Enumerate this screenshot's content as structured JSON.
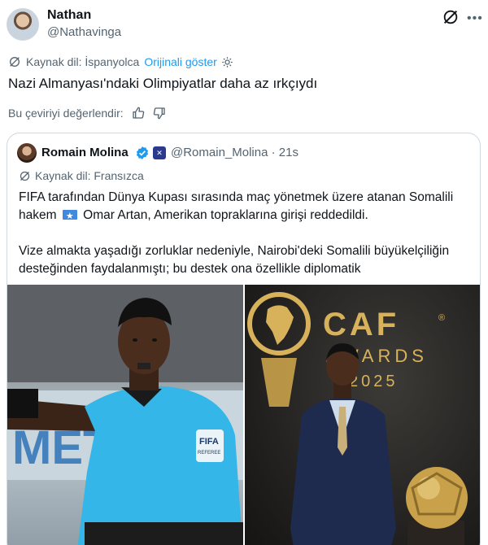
{
  "tweet": {
    "author_name": "Nathan",
    "author_handle": "@Nathavinga",
    "source_label": "Kaynak dil: İspanyolca",
    "show_original": "Orijinali göster",
    "text": "Nazi Almanyası'ndaki Olimpiyatlar daha az ırkçıydı",
    "rate_prompt": "Bu çeviriyi değerlendir:"
  },
  "quote": {
    "author_name": "Romain Molina",
    "handle_time": "@Romain_Molina · 21s",
    "source_label": "Kaynak dil: Fransızca",
    "line1": "FIFA tarafından Dünya Kupası sırasında maç yönetmek üzere atanan Somalili",
    "line2_pre": "hakem",
    "line2_post": "Omar Artan, Amerikan topraklarına girişi reddedildi.",
    "line3": "Vize almakta yaşadığı zorluklar nedeniyle, Nairobi'deki Somalili büyükelçiliğin",
    "line4": "desteğinden faydalanmıştı; bu destek ona özellikle diplomatik"
  },
  "images": {
    "left_sign": "METRO",
    "left_badge": "FIFA",
    "left_badge_sub": "REFEREE",
    "right_logo": "CAF",
    "right_reg": "®",
    "right_awards": "AWARDS",
    "right_year": "2025"
  },
  "icons": {
    "grok": "grok-icon",
    "more": "more-icon",
    "translate": "translate-icon",
    "settings": "gear-icon",
    "thumbs_up": "thumbs-up-icon",
    "thumbs_down": "thumbs-down-icon",
    "verified": "verified-badge-icon"
  },
  "colors": {
    "link": "#1d9bf0",
    "muted": "#536471",
    "text": "#0f1419",
    "border": "#cfd9de",
    "jersey": "#35b6e8",
    "caf_gold": "#d8b25a"
  }
}
